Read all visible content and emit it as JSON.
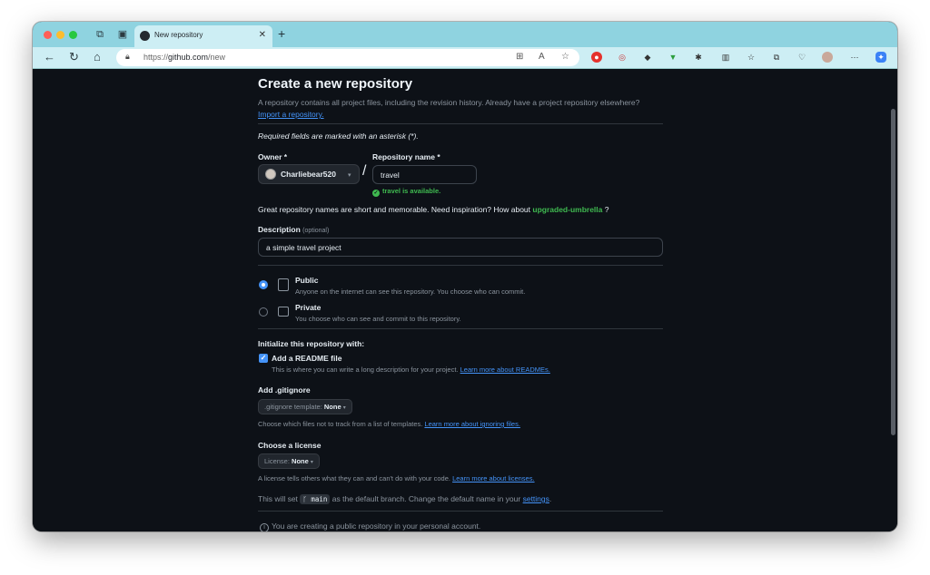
{
  "browser": {
    "tab_title": "New repository",
    "url_scheme": "https://",
    "url_host": "github.com",
    "url_path": "/new"
  },
  "page": {
    "title": "Create a new repository",
    "intro": "A repository contains all project files, including the revision history. Already have a project repository elsewhere?",
    "import_link": "Import a repository.",
    "required_note": "Required fields are marked with an asterisk (*).",
    "owner_label": "Owner *",
    "owner_value": "Charliebear520",
    "repo_label": "Repository name *",
    "repo_value": "travel",
    "availability": "travel is available.",
    "name_hint": "Great repository names are short and memorable. Need inspiration? How about",
    "name_suggestion": "upgraded-umbrella",
    "name_hint_end": "?",
    "description_label": "Description",
    "description_optional": "(optional)",
    "description_value": "a simple travel project",
    "public_title": "Public",
    "public_desc": "Anyone on the internet can see this repository. You choose who can commit.",
    "private_title": "Private",
    "private_desc": "You choose who can see and commit to this repository.",
    "init_label": "Initialize this repository with:",
    "readme_label": "Add a README file",
    "readme_desc": "This is where you can write a long description for your project.",
    "readme_link": "Learn more about READMEs.",
    "gitignore_label": "Add .gitignore",
    "gitignore_prefix": ".gitignore template:",
    "gitignore_value": "None",
    "gitignore_desc": "Choose which files not to track from a list of templates.",
    "gitignore_link": "Learn more about ignoring files.",
    "license_label": "Choose a license",
    "license_prefix": "License:",
    "license_value": "None",
    "license_desc": "A license tells others what they can and can't do with your code.",
    "license_link": "Learn more about licenses.",
    "branch_pre": "This will set",
    "branch_name": "main",
    "branch_post": "as the default branch. Change the default name in your",
    "branch_link": "settings",
    "branch_end": ".",
    "info_text": "You are creating a public repository in your personal account."
  },
  "colors": {
    "bg": "#0d1117",
    "accent_blue": "#4493f8",
    "success_green": "#3fb950",
    "tab_bar": "#8fd3e0"
  }
}
